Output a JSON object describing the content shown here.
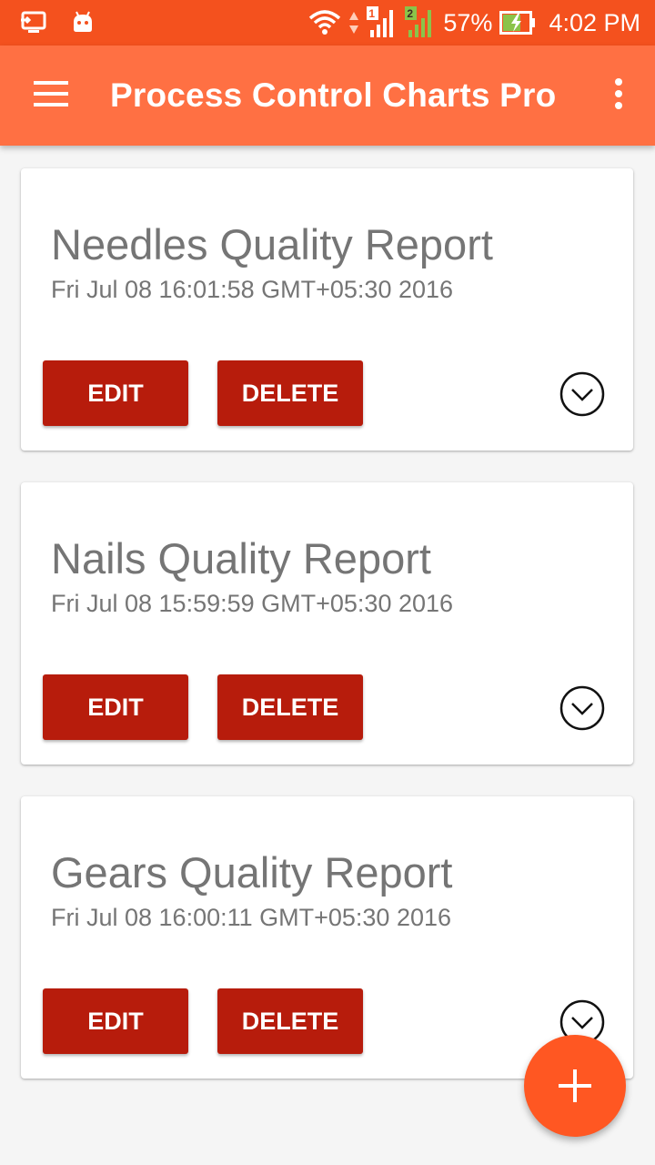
{
  "status_bar": {
    "battery_percent": "57%",
    "time": "4:02 PM",
    "sim1_label": "1",
    "sim2_label": "2",
    "icons": [
      "cast-icon",
      "android-icon",
      "wifi-icon",
      "signal-sim1-icon",
      "signal-sim2-icon",
      "battery-charging-icon"
    ]
  },
  "app_bar": {
    "title": "Process Control Charts Pro",
    "menu_icon": "hamburger-menu-icon",
    "overflow_icon": "more-vert-icon"
  },
  "reports": [
    {
      "title": "Needles Quality Report",
      "date": "Fri Jul 08 16:01:58 GMT+05:30 2016",
      "edit_label": "EDIT",
      "delete_label": "DELETE"
    },
    {
      "title": "Nails Quality Report",
      "date": "Fri Jul 08 15:59:59 GMT+05:30 2016",
      "edit_label": "EDIT",
      "delete_label": "DELETE"
    },
    {
      "title": "Gears Quality Report",
      "date": "Fri Jul 08 16:00:11 GMT+05:30 2016",
      "edit_label": "EDIT",
      "delete_label": "DELETE"
    }
  ],
  "fab": {
    "icon": "plus-icon"
  },
  "colors": {
    "status_bar": "#f4511e",
    "app_bar": "#ff7043",
    "button": "#b71c0c",
    "fab": "#ff5722",
    "text_secondary": "#757575"
  }
}
